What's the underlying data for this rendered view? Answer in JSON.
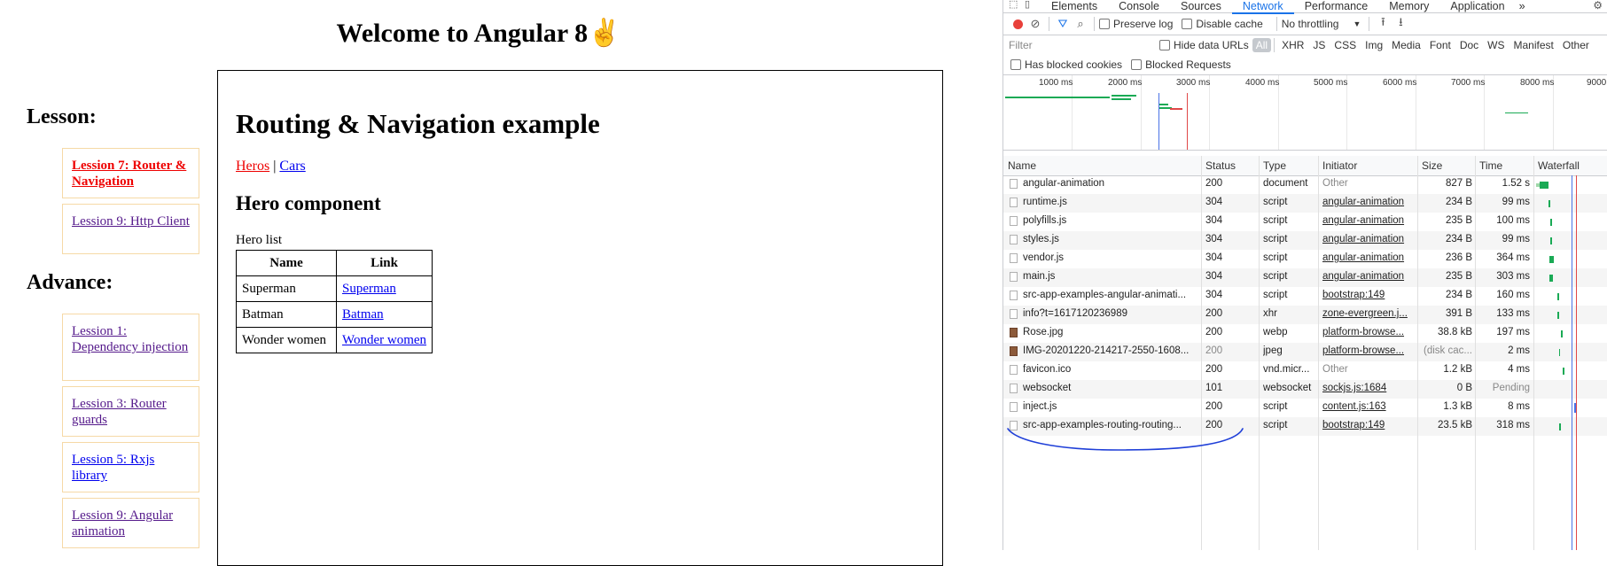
{
  "app": {
    "welcome": "Welcome to Angular 8",
    "welcome_emoji": "✌️",
    "lesson_heading": "Lesson:",
    "advance_heading": "Advance:",
    "lessons": [
      {
        "label": "Lession 7: Router & Navigation"
      },
      {
        "label": "Lession 9: Http Client"
      }
    ],
    "advance": [
      {
        "label": "Lession 1: Dependency injection"
      },
      {
        "label": "Lession 3: Router guards"
      },
      {
        "label": "Lession 5: Rxjs library"
      },
      {
        "label": "Lession 9: Angular animation"
      }
    ],
    "route_title": "Routing & Navigation example",
    "nav_links": {
      "heros": "Heros",
      "separator": " | ",
      "cars": "Cars"
    },
    "hero_title": "Hero component",
    "hero_list_label": "Hero list",
    "table": {
      "headers": [
        "Name",
        "Link"
      ],
      "rows": [
        [
          "Superman",
          "Superman"
        ],
        [
          "Batman",
          "Batman"
        ],
        [
          "Wonder women",
          "Wonder women"
        ]
      ]
    }
  },
  "devtools": {
    "tabs": [
      "Elements",
      "Console",
      "Sources",
      "Network",
      "Performance",
      "Memory",
      "Application"
    ],
    "overflow": "»",
    "toolbar": {
      "preserve_log": "Preserve log",
      "disable_cache": "Disable cache",
      "throttling": "No throttling"
    },
    "filter": {
      "placeholder": "Filter",
      "hide_data_urls": "Hide data URLs",
      "types": [
        "All",
        "XHR",
        "JS",
        "CSS",
        "Img",
        "Media",
        "Font",
        "Doc",
        "WS",
        "Manifest",
        "Other"
      ]
    },
    "has_blocked_cookies": "Has blocked cookies",
    "blocked_requests": "Blocked Requests",
    "timeline_ticks": [
      "1000 ms",
      "2000 ms",
      "3000 ms",
      "4000 ms",
      "5000 ms",
      "6000 ms",
      "7000 ms",
      "8000 ms",
      "9000"
    ],
    "columns": [
      "Name",
      "Status",
      "Type",
      "Initiator",
      "Size",
      "Time",
      "Waterfall"
    ],
    "rows": [
      {
        "name": "angular-animation",
        "status": "200",
        "type": "document",
        "initiator": "Other",
        "size": "827 B",
        "time": "1.52 s"
      },
      {
        "name": "runtime.js",
        "status": "304",
        "type": "script",
        "initiator": "angular-animation",
        "size": "234 B",
        "time": "99 ms"
      },
      {
        "name": "polyfills.js",
        "status": "304",
        "type": "script",
        "initiator": "angular-animation",
        "size": "235 B",
        "time": "100 ms"
      },
      {
        "name": "styles.js",
        "status": "304",
        "type": "script",
        "initiator": "angular-animation",
        "size": "234 B",
        "time": "99 ms"
      },
      {
        "name": "vendor.js",
        "status": "304",
        "type": "script",
        "initiator": "angular-animation",
        "size": "236 B",
        "time": "364 ms"
      },
      {
        "name": "main.js",
        "status": "304",
        "type": "script",
        "initiator": "angular-animation",
        "size": "235 B",
        "time": "303 ms"
      },
      {
        "name": "src-app-examples-angular-animati...",
        "status": "304",
        "type": "script",
        "initiator": "bootstrap:149",
        "size": "234 B",
        "time": "160 ms"
      },
      {
        "name": "info?t=1617120236989",
        "status": "200",
        "type": "xhr",
        "initiator": "zone-evergreen.j...",
        "size": "391 B",
        "time": "133 ms"
      },
      {
        "name": "Rose.jpg",
        "status": "200",
        "type": "webp",
        "initiator": "platform-browse...",
        "size": "38.8 kB",
        "time": "197 ms"
      },
      {
        "name": "IMG-20201220-214217-2550-1608...",
        "status": "200",
        "type": "jpeg",
        "initiator": "platform-browse...",
        "size": "(disk cac...",
        "time": "2 ms"
      },
      {
        "name": "favicon.ico",
        "status": "200",
        "type": "vnd.micr...",
        "initiator": "Other",
        "size": "1.2 kB",
        "time": "4 ms"
      },
      {
        "name": "websocket",
        "status": "101",
        "type": "websocket",
        "initiator": "sockjs.js:1684",
        "size": "0 B",
        "time": "Pending"
      },
      {
        "name": "inject.js",
        "status": "200",
        "type": "script",
        "initiator": "content.js:163",
        "size": "1.3 kB",
        "time": "8 ms"
      },
      {
        "name": "src-app-examples-routing-routing...",
        "status": "200",
        "type": "script",
        "initiator": "bootstrap:149",
        "size": "23.5 kB",
        "time": "318 ms"
      }
    ],
    "annotation_color": "#1f3fd8"
  }
}
